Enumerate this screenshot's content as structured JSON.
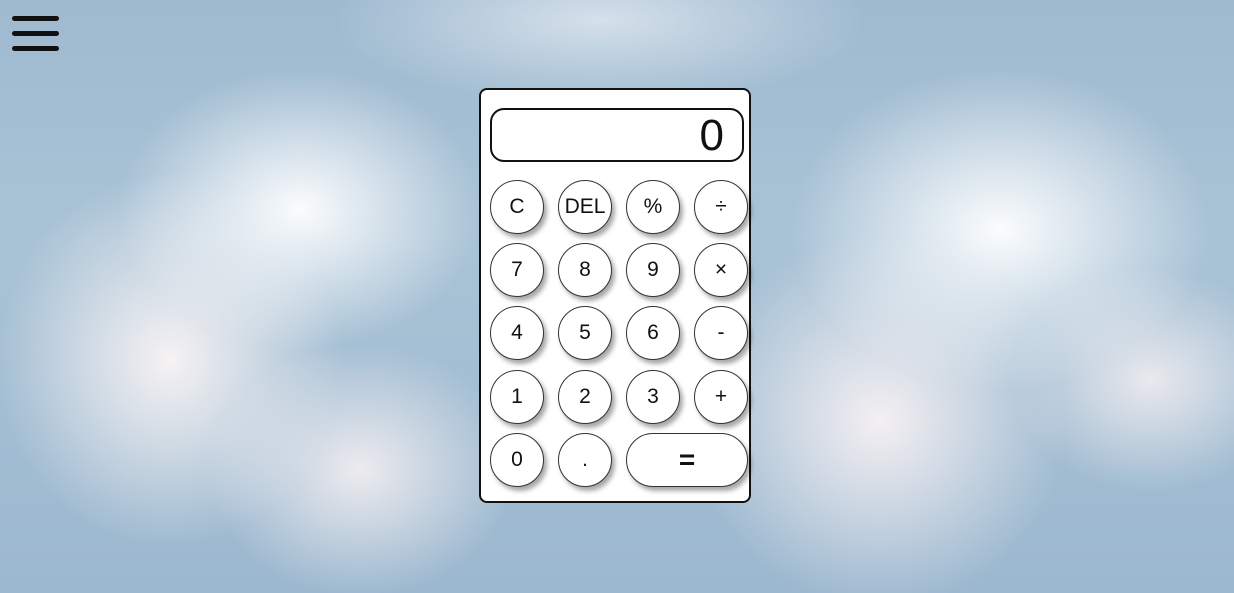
{
  "menu": {
    "icon": "hamburger-menu-icon"
  },
  "display": {
    "value": "0"
  },
  "keys": {
    "clear": "C",
    "delete": "DEL",
    "percent": "%",
    "divide": "÷",
    "seven": "7",
    "eight": "8",
    "nine": "9",
    "multiply": "×",
    "four": "4",
    "five": "5",
    "six": "6",
    "subtract": "-",
    "one": "1",
    "two": "2",
    "three": "3",
    "add": "+",
    "zero": "0",
    "decimal": ".",
    "equals": "="
  }
}
